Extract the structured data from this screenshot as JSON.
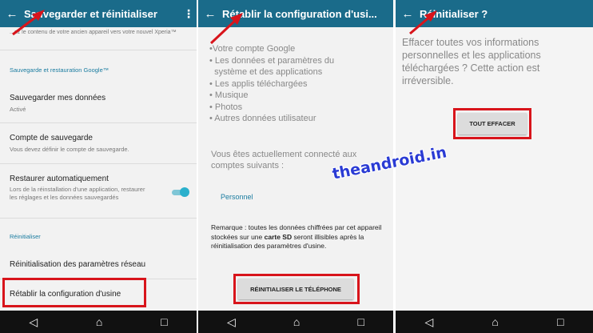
{
  "colors": {
    "appbar": "#1a6b8a",
    "accent": "#1a7ca0",
    "highlight": "#d8141b",
    "toggle": "#2bb0cc",
    "watermark": "#2a3bd4"
  },
  "icons": {
    "back": "arrow-left-icon",
    "more": "more-vert-icon",
    "nav_back": "triangle-back-icon",
    "nav_home": "home-icon",
    "nav_recent": "square-recent-icon"
  },
  "panel1": {
    "title": "Sauvegarder et réinitialiser",
    "truncated_text": "...ez le contenu de votre ancien appareil vers votre nouvel Xperia™",
    "section_google": "Sauvegarde et restauration Google™",
    "backup_title": "Sauvegarder mes données",
    "backup_sub": "Activé",
    "account_title": "Compte de sauvegarde",
    "account_sub": "Vous devez définir le compte de sauvegarde.",
    "restore_title": "Restaurer automatiquement",
    "restore_sub": "Lors de la réinstallation d'une application, restaurer les réglages et les données sauvegardés",
    "restore_toggle_on": true,
    "section_reset": "Réinitialiser",
    "network_reset": "Réinitialisation des paramètres réseau",
    "factory_reset": "Rétablir la configuration d'usine"
  },
  "panel2": {
    "title": "Rétablir la configuration d'usi...",
    "items": [
      "•Votre compte Google",
      "• Les données et paramètres du",
      "  système et des applications",
      "• Les applis téléchargées",
      "• Musique",
      "• Photos",
      "• Autres données utilisateur"
    ],
    "connected_text": "Vous êtes actuellement connecté aux comptes suivants :",
    "account_name": "Personnel",
    "note_prefix": "Remarque : toutes les données chiffrées par cet appareil stockées sur une ",
    "note_bold": "carte SD",
    "note_suffix": " seront illisibles après la réinitialisation des paramètres d'usine.",
    "reset_button": "RÉINITIALISER LE TÉLÉPHONE"
  },
  "panel3": {
    "title": "Réinitialiser ?",
    "message": "Effacer toutes vos informations personnelles et les applications téléchargées ? Cette action est irréversible.",
    "erase_button": "TOUT EFFACER"
  },
  "navbar": {
    "back": "◁",
    "home": "⌂",
    "recent": "□"
  },
  "watermark": "theandroid.in"
}
